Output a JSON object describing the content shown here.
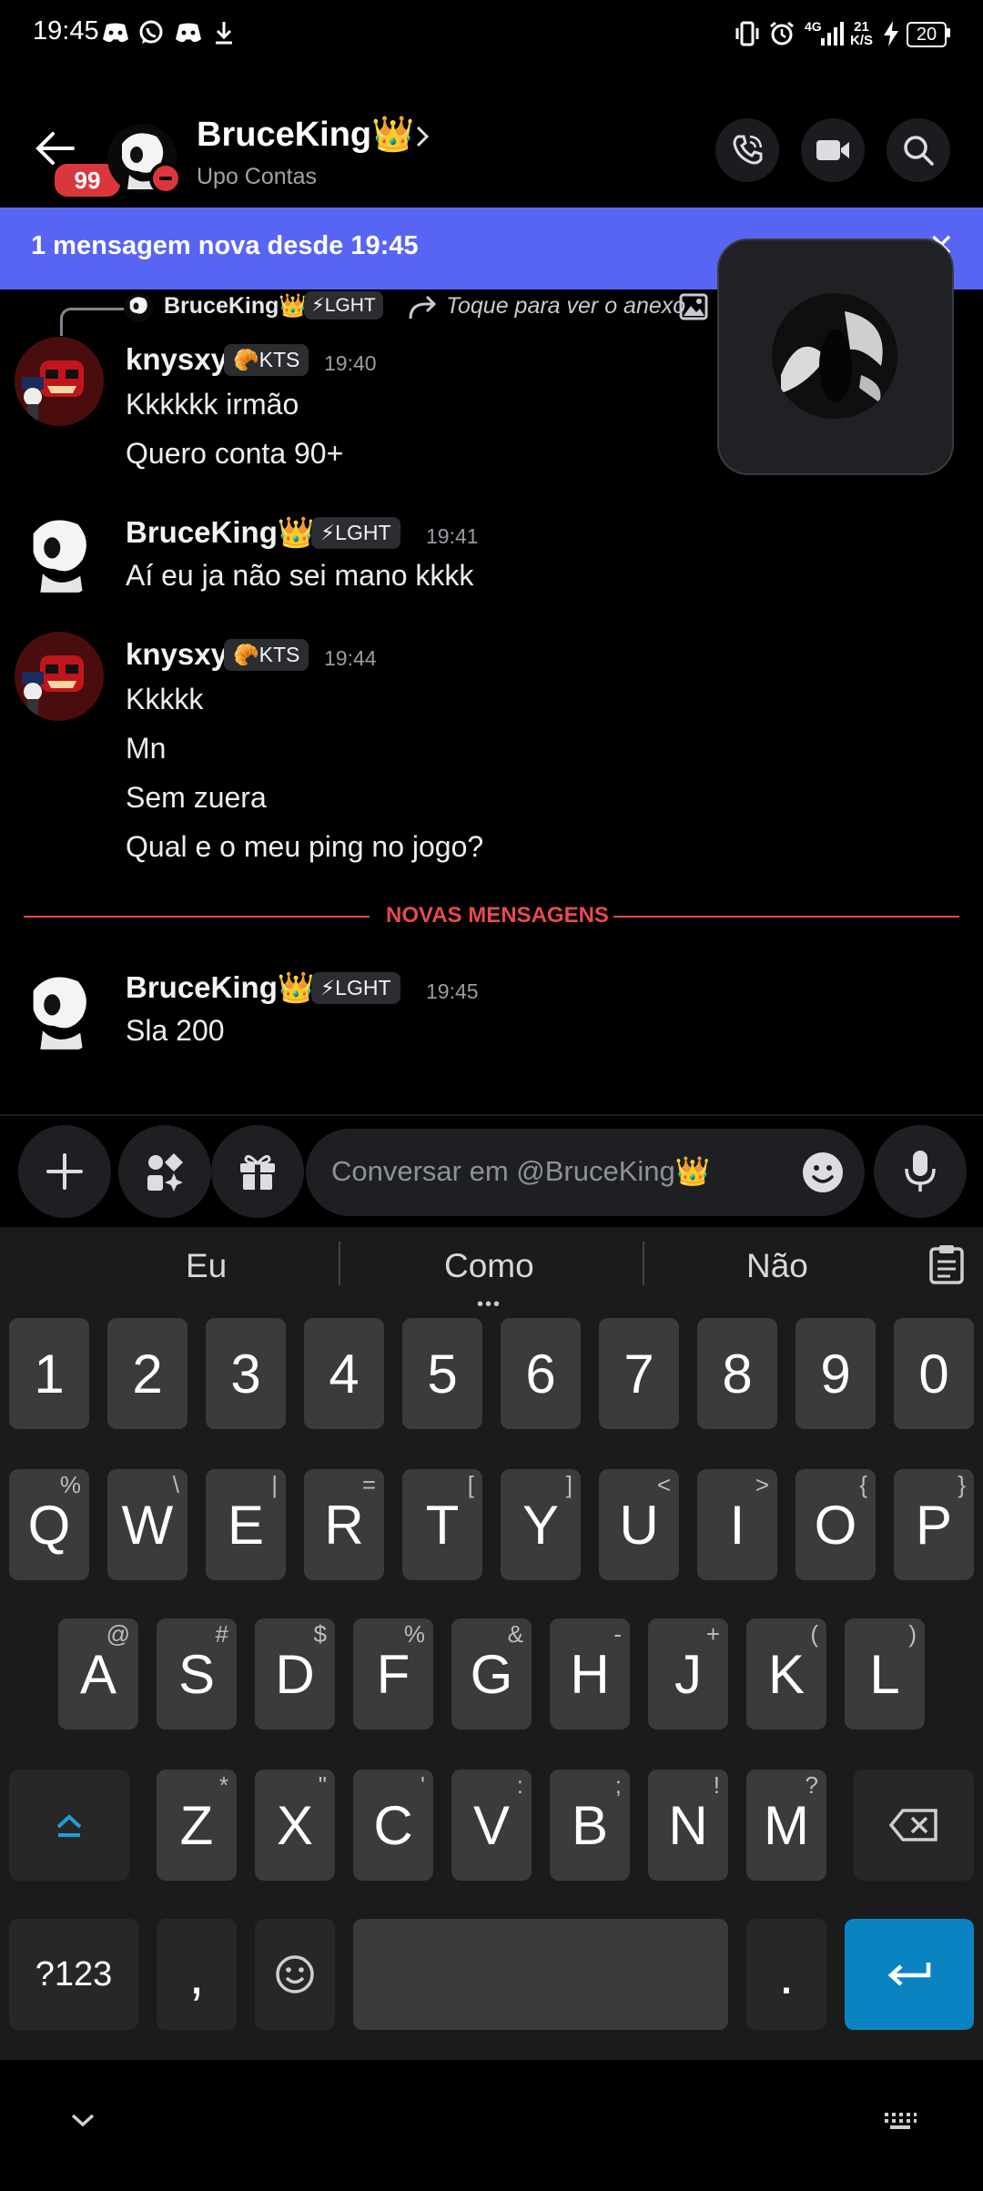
{
  "status_bar": {
    "time": "19:45",
    "notification_icons": [
      "discord-icon",
      "whatsapp-icon",
      "discord-icon",
      "download-icon"
    ],
    "network": "4G",
    "speed_value": "21",
    "speed_unit": "K/S",
    "battery": "20"
  },
  "header": {
    "unread_badge": "99",
    "title": "BruceKing👑",
    "subtitle": "Upo Contas"
  },
  "banner": {
    "text": "1 mensagem nova desde 19:45",
    "close_glyph": "✕"
  },
  "reply_preview": {
    "author": "BruceKing👑",
    "tag": "⚡LGHT",
    "text": "Toque para ver o anexo"
  },
  "messages": [
    {
      "author": "knysxy",
      "tag": "🥐KTS",
      "time": "19:40",
      "lines": [
        "Kkkkkk irmão",
        "Quero conta 90+"
      ]
    },
    {
      "author": "BruceKing👑",
      "tag": "⚡LGHT",
      "time": "19:41",
      "lines": [
        "Aí eu ja não sei mano kkkk"
      ]
    },
    {
      "author": "knysxy",
      "tag": "🥐KTS",
      "time": "19:44",
      "lines": [
        "Kkkkk",
        "Mn",
        "Sem zuera",
        "Qual e o meu ping no jogo?"
      ]
    },
    {
      "author": "BruceKing👑",
      "tag": "⚡LGHT",
      "time": "19:45",
      "lines": [
        "Sla 200"
      ]
    }
  ],
  "divider": {
    "label": "NOVAS MENSAGENS"
  },
  "composer": {
    "placeholder": "Conversar em @BruceKing👑"
  },
  "keyboard": {
    "suggestions": [
      "Eu",
      "Como",
      "Não"
    ],
    "number_row": [
      "1",
      "2",
      "3",
      "4",
      "5",
      "6",
      "7",
      "8",
      "9",
      "0"
    ],
    "row1": [
      [
        "Q",
        "%"
      ],
      [
        "W",
        "\\"
      ],
      [
        "E",
        "|"
      ],
      [
        "R",
        "="
      ],
      [
        "T",
        "["
      ],
      [
        "Y",
        "]"
      ],
      [
        "U",
        "<"
      ],
      [
        "I",
        ">"
      ],
      [
        "O",
        "{"
      ],
      [
        "P",
        "}"
      ]
    ],
    "row2": [
      [
        "A",
        "@"
      ],
      [
        "S",
        "#"
      ],
      [
        "D",
        "$"
      ],
      [
        "F",
        "%"
      ],
      [
        "G",
        "&"
      ],
      [
        "H",
        "-"
      ],
      [
        "J",
        "+"
      ],
      [
        "K",
        "("
      ],
      [
        "L",
        ")"
      ]
    ],
    "row3": [
      [
        "Z",
        "*"
      ],
      [
        "X",
        "\""
      ],
      [
        "C",
        "'"
      ],
      [
        "V",
        ":"
      ],
      [
        "B",
        ";"
      ],
      [
        "N",
        "!"
      ],
      [
        "M",
        "?"
      ]
    ],
    "symbols_key": "?123",
    "comma_key": ",",
    "period_key": "."
  },
  "colors": {
    "accent": "#5865f2",
    "badge": "#da373c",
    "divider": "#e84a4f",
    "enter_key": "#0a84c0"
  }
}
